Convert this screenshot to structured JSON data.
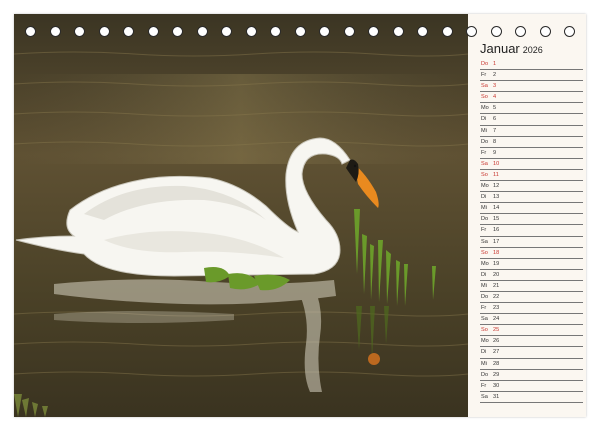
{
  "calendar": {
    "month": "Januar",
    "year": "2026",
    "sunday_color": "#c8342d",
    "days": [
      {
        "wd": "Do",
        "d": "1",
        "sun": true
      },
      {
        "wd": "Fr",
        "d": "2"
      },
      {
        "wd": "Sa",
        "d": "3",
        "sun": true
      },
      {
        "wd": "So",
        "d": "4",
        "sun": true
      },
      {
        "wd": "Mo",
        "d": "5"
      },
      {
        "wd": "Di",
        "d": "6"
      },
      {
        "wd": "Mi",
        "d": "7"
      },
      {
        "wd": "Do",
        "d": "8"
      },
      {
        "wd": "Fr",
        "d": "9"
      },
      {
        "wd": "Sa",
        "d": "10",
        "sun": true
      },
      {
        "wd": "So",
        "d": "11",
        "sun": true
      },
      {
        "wd": "Mo",
        "d": "12"
      },
      {
        "wd": "Di",
        "d": "13"
      },
      {
        "wd": "Mi",
        "d": "14"
      },
      {
        "wd": "Do",
        "d": "15"
      },
      {
        "wd": "Fr",
        "d": "16"
      },
      {
        "wd": "Sa",
        "d": "17"
      },
      {
        "wd": "So",
        "d": "18",
        "sun": true
      },
      {
        "wd": "Mo",
        "d": "19"
      },
      {
        "wd": "Di",
        "d": "20"
      },
      {
        "wd": "Mi",
        "d": "21"
      },
      {
        "wd": "Do",
        "d": "22"
      },
      {
        "wd": "Fr",
        "d": "23"
      },
      {
        "wd": "Sa",
        "d": "24"
      },
      {
        "wd": "So",
        "d": "25",
        "sun": true
      },
      {
        "wd": "Mo",
        "d": "26"
      },
      {
        "wd": "Di",
        "d": "27"
      },
      {
        "wd": "Mi",
        "d": "28"
      },
      {
        "wd": "Do",
        "d": "29"
      },
      {
        "wd": "Fr",
        "d": "30"
      },
      {
        "wd": "Sa",
        "d": "31"
      }
    ]
  },
  "photo": {
    "subject": "white-swan-on-pond",
    "water_color": "#5b4e33",
    "swan_color": "#f7f6f1",
    "beak_color": "#e98a1f",
    "reed_color": "#6a9a2a"
  },
  "binding": {
    "hole_count": 23
  }
}
